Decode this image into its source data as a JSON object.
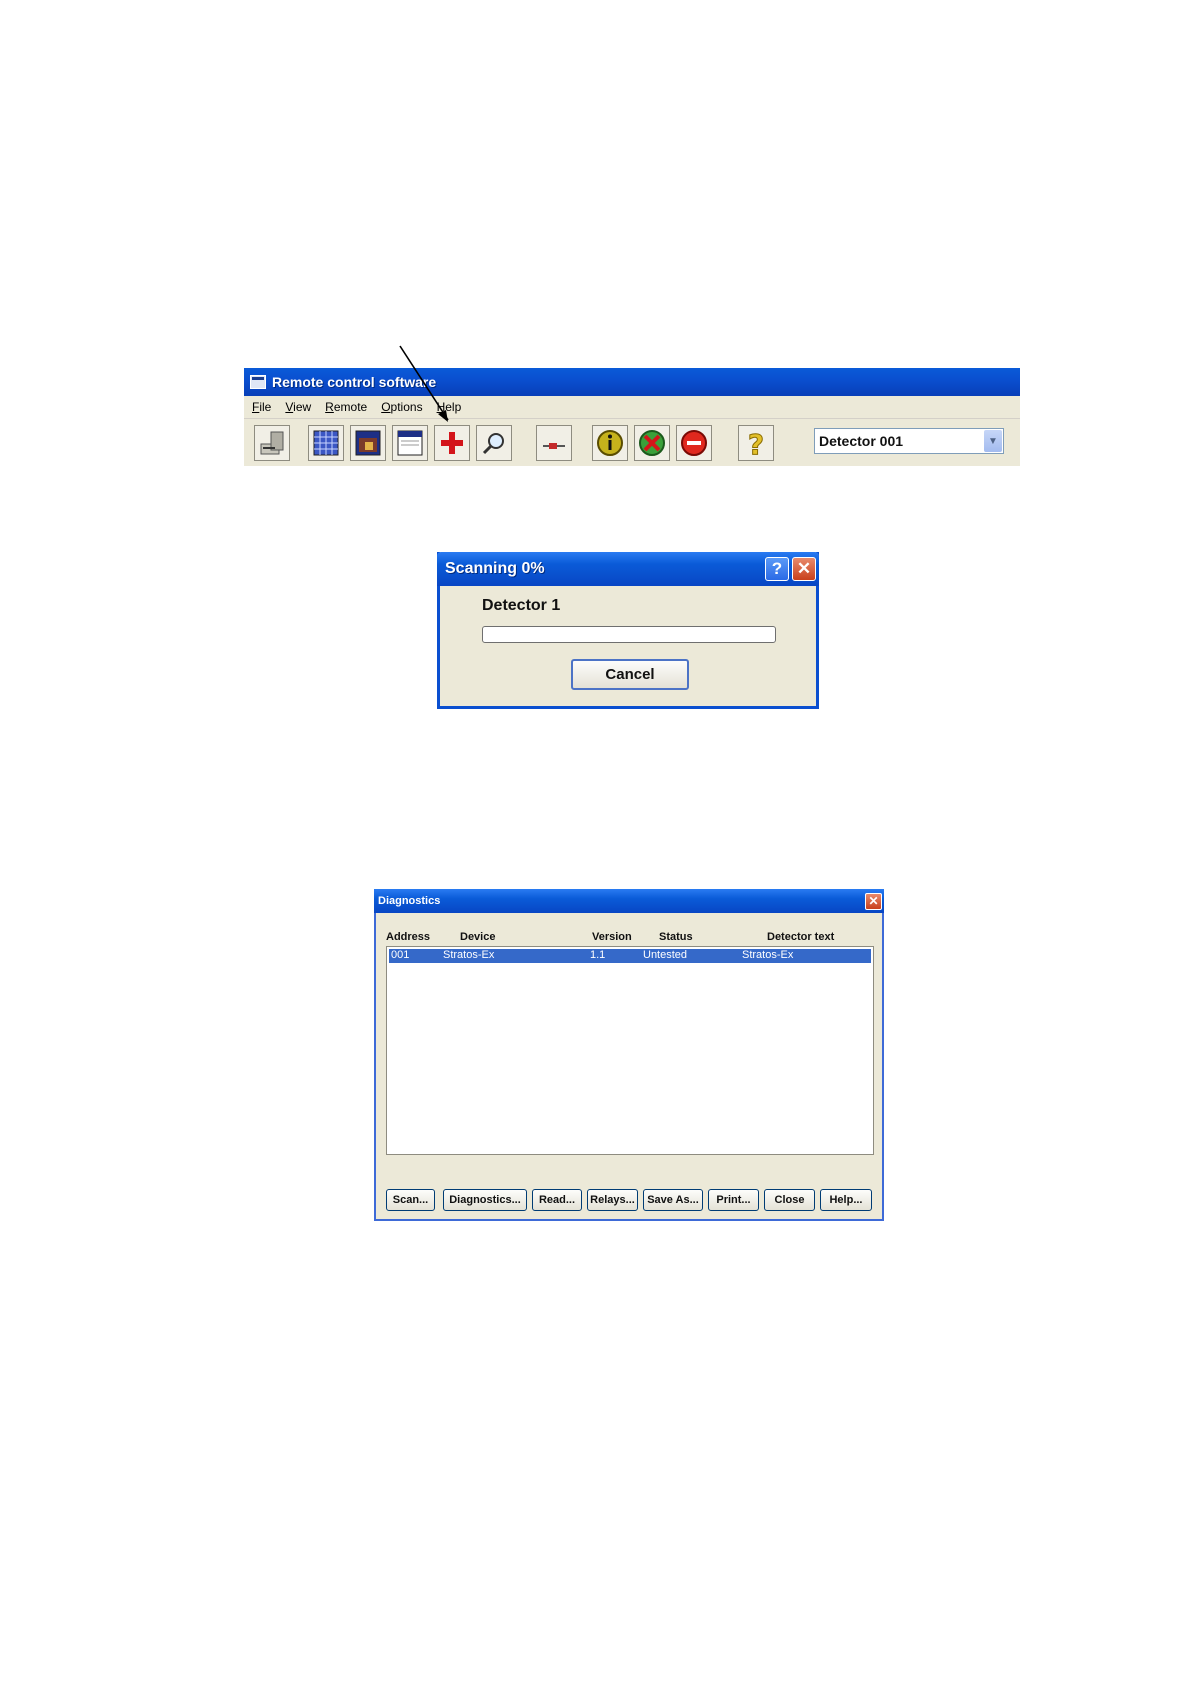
{
  "remote_window": {
    "title": "Remote control software",
    "menu": [
      "File",
      "View",
      "Remote",
      "Options",
      "Help"
    ],
    "toolbar_icons": [
      "exit-icon",
      "grid-view-icon",
      "window-icon",
      "form-icon",
      "add-scan-icon",
      "magnifier-icon",
      "slider-icon",
      "info-icon",
      "remove-icon",
      "stop-icon",
      "help-icon"
    ],
    "detector_select": "Detector 001"
  },
  "scan_dialog": {
    "title": "Scanning 0%",
    "detector_label": "Detector 1",
    "progress_percent": 0,
    "cancel_label": "Cancel"
  },
  "diagnostics": {
    "title": "Diagnostics",
    "columns": [
      "Address",
      "Device",
      "Version",
      "Status",
      "Detector text"
    ],
    "rows": [
      {
        "address": "001",
        "device": "Stratos-Ex",
        "version": "1.1",
        "status": "Untested",
        "detector_text": "Stratos-Ex"
      }
    ],
    "buttons": [
      "Scan...",
      "Diagnostics...",
      "Read...",
      "Relays...",
      "Save As...",
      "Print...",
      "Close",
      "Help..."
    ]
  },
  "colors": {
    "xp_title_blue": "#0a5bd8",
    "selection_blue": "#3569c9",
    "window_face": "#ece9d8"
  }
}
